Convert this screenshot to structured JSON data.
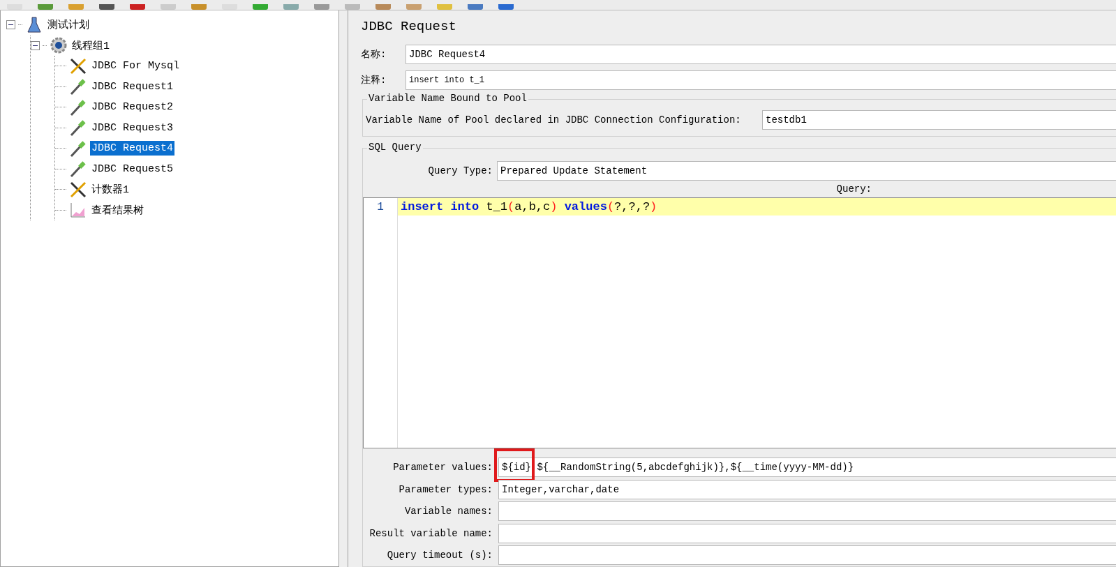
{
  "tree": [
    {
      "label": "测试计划",
      "kind": "flask",
      "expanded": true,
      "selected": false,
      "children": [
        {
          "label": "线程组1",
          "kind": "gear",
          "expanded": true,
          "selected": false,
          "children": [
            {
              "label": "JDBC For Mysql",
              "kind": "tools",
              "selected": false
            },
            {
              "label": "JDBC Request1",
              "kind": "dropper",
              "selected": false
            },
            {
              "label": "JDBC Request2",
              "kind": "dropper",
              "selected": false
            },
            {
              "label": "JDBC Request3",
              "kind": "dropper",
              "selected": false
            },
            {
              "label": "JDBC Request4",
              "kind": "dropper",
              "selected": true
            },
            {
              "label": "JDBC Request5",
              "kind": "dropper",
              "selected": false
            },
            {
              "label": "计数器1",
              "kind": "tools",
              "selected": false
            },
            {
              "label": "查看结果树",
              "kind": "chart",
              "selected": false
            }
          ]
        }
      ]
    }
  ],
  "panel": {
    "title": "JDBC Request",
    "name": {
      "label": "名称:",
      "value": "JDBC Request4"
    },
    "comment": {
      "label": "注释:",
      "value": "insert into t_1"
    },
    "pool_group": {
      "title": "Variable Name Bound to Pool",
      "label": "Variable Name of Pool declared in JDBC Connection Configuration:",
      "value": "testdb1"
    },
    "sql_group": {
      "title": "SQL Query",
      "query_type": {
        "label": "Query Type:",
        "value": "Prepared Update Statement"
      },
      "query_label": "Query:",
      "editor": {
        "line_number": "1",
        "tokens": [
          {
            "kind": "keyword",
            "text": "insert into"
          },
          {
            "kind": "plain",
            "text": " t_1"
          },
          {
            "kind": "paren",
            "text": "("
          },
          {
            "kind": "plain",
            "text": "a,b,c"
          },
          {
            "kind": "paren",
            "text": ")"
          },
          {
            "kind": "keyword",
            "text": " values"
          },
          {
            "kind": "paren",
            "text": "("
          },
          {
            "kind": "plain",
            "text": "?,?,?"
          },
          {
            "kind": "paren",
            "text": ")"
          }
        ]
      }
    },
    "params": [
      {
        "label": "Parameter values:",
        "value": "${id} ${__RandomString(5,abcdefghijk)},${__time(yyyy-MM-dd)}",
        "highlighted": true
      },
      {
        "label": "Parameter types:",
        "value": "Integer,varchar,date",
        "highlighted": false
      },
      {
        "label": "Variable names:",
        "highlighted": false
      },
      {
        "label": "Result variable name:",
        "highlighted": false
      },
      {
        "label": "Query timeout (s):",
        "highlighted": false
      }
    ]
  }
}
